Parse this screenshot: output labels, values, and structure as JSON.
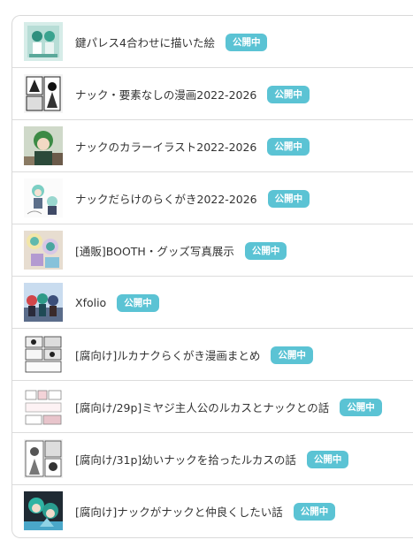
{
  "colors": {
    "badge": "#5bc3d4",
    "border": "#d9d9d9",
    "text": "#333333"
  },
  "status_label": "公開中",
  "items": [
    {
      "title": "鍵パレス4合わせに描いた絵",
      "status": "公開中",
      "thumb_icon": "teal-character-thumbnail-icon"
    },
    {
      "title": "ナック・要素なしの漫画2022-2026",
      "status": "公開中",
      "thumb_icon": "manga-page-thumbnail-icon"
    },
    {
      "title": "ナックのカラーイラスト2022-2026",
      "status": "公開中",
      "thumb_icon": "color-illustration-thumbnail-icon"
    },
    {
      "title": "ナックだらけのらくがき2022-2026",
      "status": "公開中",
      "thumb_icon": "sketch-thumbnail-icon"
    },
    {
      "title": "[通販]BOOTH・グッズ写真展示",
      "status": "公開中",
      "thumb_icon": "merch-photo-thumbnail-icon"
    },
    {
      "title": "Xfolio",
      "status": "公開中",
      "thumb_icon": "group-illustration-thumbnail-icon"
    },
    {
      "title": "[腐向け]ルカナクらくがき漫画まとめ",
      "status": "公開中",
      "thumb_icon": "comic-strip-thumbnail-icon"
    },
    {
      "title": "[腐向け/29p]ミヤジ主人公のルカスとナックとの話",
      "status": "公開中",
      "thumb_icon": "comic-page-thumbnail-icon"
    },
    {
      "title": "[腐向け/31p]幼いナックを拾ったルカスの話",
      "status": "公開中",
      "thumb_icon": "comic-panels-thumbnail-icon"
    },
    {
      "title": "[腐向け]ナックがナックと仲良くしたい話",
      "status": "公開中",
      "thumb_icon": "cover-art-thumbnail-icon"
    }
  ]
}
